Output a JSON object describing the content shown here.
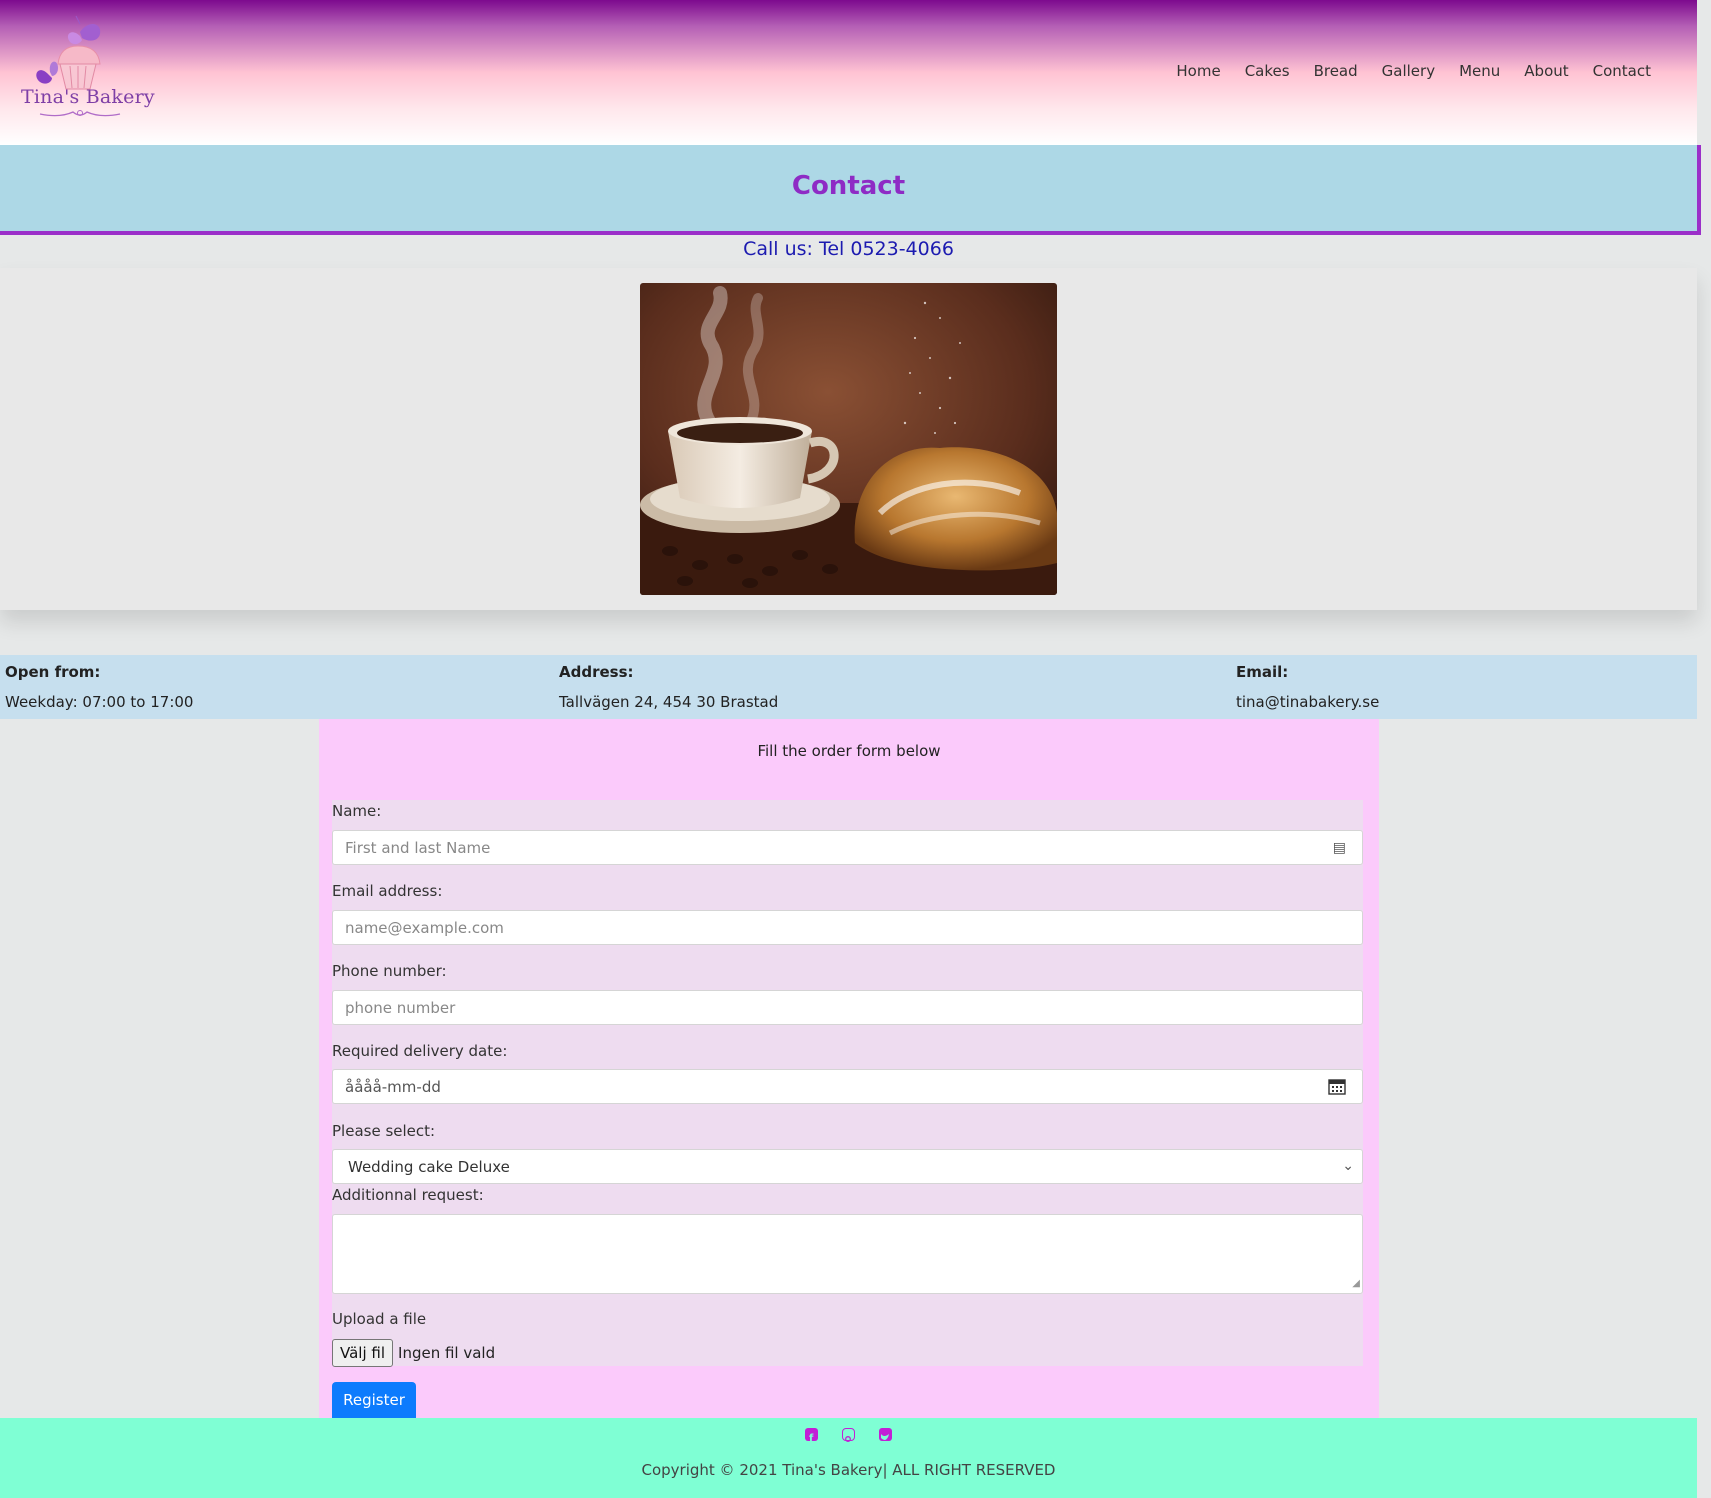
{
  "brand": {
    "name": "Tina's Bakery"
  },
  "nav": {
    "items": [
      {
        "label": "Home"
      },
      {
        "label": "Cakes"
      },
      {
        "label": "Bread"
      },
      {
        "label": "Gallery"
      },
      {
        "label": "Menu"
      },
      {
        "label": "About"
      },
      {
        "label": "Contact"
      }
    ]
  },
  "page": {
    "title": "Contact",
    "call": "Call us: Tel 0523-4066"
  },
  "info": {
    "open_label": "Open from:",
    "open_value": "Weekday: 07:00 to 17:00",
    "address_label": "Address:",
    "address_value": "Tallvägen 24, 454 30 Brastad",
    "email_label": "Email:",
    "email_value": "tina@tinabakery.se"
  },
  "form": {
    "intro": "Fill the order form below",
    "name_label": "Name:",
    "name_placeholder": "First and last Name",
    "email_label": "Email address:",
    "email_placeholder": "name@example.com",
    "phone_label": "Phone number:",
    "phone_placeholder": "phone number",
    "date_label": "Required delivery date:",
    "date_placeholder": "åååå-mm-dd",
    "select_label": "Please select:",
    "select_value": "Wedding cake Deluxe",
    "request_label": "Additionnal request:",
    "upload_label": "Upload a file",
    "file_button": "Välj fil",
    "file_status": "Ingen fil vald",
    "register_label": "Register"
  },
  "footer": {
    "social_icons": [
      "facebook-icon",
      "instagram-icon",
      "twitter-icon"
    ],
    "copyright": "Copyright © 2021 Tina's Bakery| ALL RIGHT RESERVED"
  },
  "colors": {
    "title": "#8e2bc5",
    "title_band": "#add8e6",
    "call_text": "#1c1bb0",
    "info_bar": "#c6dfee",
    "form_bg": "#fbcafb",
    "form_inner": "#eedcf0",
    "register_button": "#0d7bfd",
    "footer_bg": "#7fffd4",
    "social_icon": "#c21fd6"
  }
}
